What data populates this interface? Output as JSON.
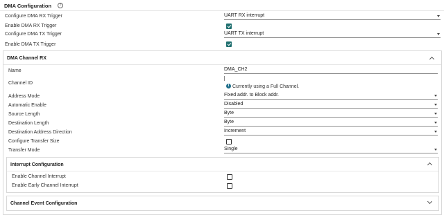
{
  "dma_config": {
    "title": "DMA Configuration",
    "help_glyph": "?",
    "rows": [
      {
        "label": "Configure DMA RX Trigger",
        "type": "select",
        "value": "UART RX interrupt"
      },
      {
        "label": "Enable DMA RX Trigger",
        "type": "checkbox",
        "checked": true
      },
      {
        "label": "Configure DMA TX Trigger",
        "type": "select",
        "value": "UART TX interrupt"
      },
      {
        "label": "Enable DMA TX Trigger",
        "type": "checkbox",
        "checked": true
      }
    ]
  },
  "channel_rx": {
    "title": "DMA Channel RX",
    "name_label": "Name",
    "name_value": "DMA_CH2",
    "channel_id_label": "Channel ID",
    "channel_id_info": "Currently using a Full Channel.",
    "info_glyph": "i",
    "rows": [
      {
        "label": "Address Mode",
        "type": "select",
        "value": "Fixed addr. to Block addr."
      },
      {
        "label": "Automatic Enable",
        "type": "select",
        "value": "Disabled"
      },
      {
        "label": "Source Length",
        "type": "select",
        "value": "Byte"
      },
      {
        "label": "Destination Length",
        "type": "select",
        "value": "Byte"
      },
      {
        "label": "Destination Address Direction",
        "type": "select",
        "value": "Increment"
      },
      {
        "label": "Configure Transfer Size",
        "type": "checkbox",
        "checked": false
      },
      {
        "label": "Transfer Mode",
        "type": "select",
        "value": "Single"
      }
    ]
  },
  "interrupt_config": {
    "title": "Interrupt Configuration",
    "rows": [
      {
        "label": "Enable Channel Interrupt",
        "type": "checkbox",
        "checked": false
      },
      {
        "label": "Enable Early Channel Interrupt",
        "type": "checkbox",
        "checked": false
      }
    ]
  },
  "channel_event": {
    "title": "Channel Event Configuration"
  }
}
